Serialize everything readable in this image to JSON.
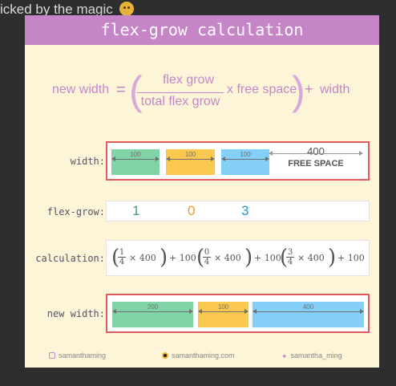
{
  "top_text": "icked by the magic",
  "title": "flex-grow calculation",
  "formula": {
    "lhs": "new width",
    "equals": "=",
    "numerator": "flex grow",
    "denominator": "total flex grow",
    "times_text": "x free space",
    "plus": "+",
    "rhs": "width"
  },
  "labels": {
    "width": "width:",
    "flex_grow": "flex-grow:",
    "calculation": "calculation:",
    "new_width": "new width:"
  },
  "width_row": {
    "segments": [
      {
        "value": "100",
        "color": "#7fd4a6"
      },
      {
        "value": "100",
        "color": "#fbc84f"
      },
      {
        "value": "100",
        "color": "#83cff7"
      }
    ],
    "free_value": "400",
    "free_label": "FREE SPACE"
  },
  "flex_grow_row": {
    "values": [
      {
        "value": "1",
        "color": "#3f9f7d"
      },
      {
        "value": "0",
        "color": "#e9a21a"
      },
      {
        "value": "3",
        "color": "#2a95c9"
      }
    ]
  },
  "calculation_row": {
    "terms": [
      {
        "num": "1",
        "den": "4",
        "times": "× 400",
        "plus": "+ 100"
      },
      {
        "num": "0",
        "den": "4",
        "times": "× 400",
        "plus": "+ 100"
      },
      {
        "num": "3",
        "den": "4",
        "times": "× 400",
        "plus": "+ 100"
      }
    ]
  },
  "new_width_row": {
    "segments": [
      {
        "value": "200",
        "color": "#7fd4a6"
      },
      {
        "value": "100",
        "color": "#fbc84f"
      },
      {
        "value": "400",
        "color": "#83cff7"
      }
    ]
  },
  "footer": {
    "instagram": "samanthaming",
    "website": "samanthaming.com",
    "twitter": "samantha_ming"
  },
  "colors": {
    "header_bg": "#c585c7",
    "card_bg": "#fdf5d8",
    "highlight_border": "#e35b5b"
  }
}
